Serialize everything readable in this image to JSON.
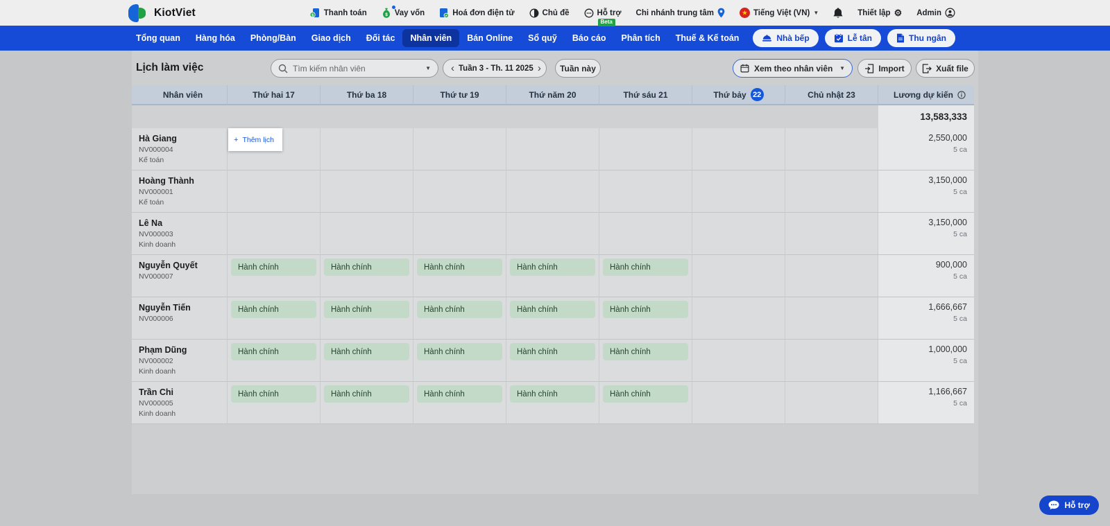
{
  "topbar": {
    "brand": "KiotViet",
    "items": [
      {
        "label": "Thanh toán"
      },
      {
        "label": "Vay vốn"
      },
      {
        "label": "Hoá đơn điện tử"
      },
      {
        "label": "Chủ đề"
      },
      {
        "label": "Hỗ trợ",
        "beta": "Beta"
      },
      {
        "label": "Chi nhánh trung tâm"
      },
      {
        "label": "Tiếng Việt (VN)"
      },
      {
        "label": "Thiết lập"
      },
      {
        "label": "Admin"
      }
    ]
  },
  "navbar": {
    "items": [
      "Tổng quan",
      "Hàng hóa",
      "Phòng/Bàn",
      "Giao dịch",
      "Đối tác",
      "Nhân viên",
      "Bán Online",
      "Sổ quỹ",
      "Báo cáo",
      "Phân tích",
      "Thuế & Kế toán"
    ],
    "active_index": 5,
    "quick_buttons": [
      "Nhà bếp",
      "Lễ tân",
      "Thu ngân"
    ]
  },
  "toolbar": {
    "title": "Lịch làm việc",
    "search_placeholder": "Tìm kiếm nhân viên",
    "week_label": "Tuần 3 - Th. 11 2025",
    "this_week_label": "Tuần này",
    "view_select_label": "Xem theo nhân viên",
    "import_label": "Import",
    "export_label": "Xuất file"
  },
  "table": {
    "columns": [
      {
        "label": "Nhân viên"
      },
      {
        "label": "Thứ hai 17"
      },
      {
        "label": "Thứ ba 18"
      },
      {
        "label": "Thứ tư 19"
      },
      {
        "label": "Thứ năm 20"
      },
      {
        "label": "Thứ sáu 21"
      },
      {
        "label": "Thứ bảy",
        "badge": "22",
        "active": true
      },
      {
        "label": "Chủ nhật 23",
        "muted": true
      },
      {
        "label": "Lương dự kiến",
        "info": true
      }
    ],
    "summary_total": "13,583,333",
    "add_shift_label": "Thêm lịch",
    "rows": [
      {
        "name": "Hà Giang",
        "code": "NV000004",
        "dept": "Kế toán",
        "shifts": [
          "",
          "",
          "",
          "",
          "",
          "",
          ""
        ],
        "salary": "2,550,000",
        "shift_count": "5 ca",
        "show_add_popup": true
      },
      {
        "name": "Hoàng Thành",
        "code": "NV000001",
        "dept": "Kế toán",
        "shifts": [
          "",
          "",
          "",
          "",
          "",
          "",
          ""
        ],
        "salary": "3,150,000",
        "shift_count": "5 ca"
      },
      {
        "name": "Lê Na",
        "code": "NV000003",
        "dept": "Kinh doanh",
        "shifts": [
          "",
          "",
          "",
          "",
          "",
          "",
          ""
        ],
        "salary": "3,150,000",
        "shift_count": "5 ca"
      },
      {
        "name": "Nguyễn Quyết",
        "code": "NV000007",
        "dept": "",
        "shifts": [
          "Hành chính",
          "Hành chính",
          "Hành chính",
          "Hành chính",
          "Hành chính",
          "",
          ""
        ],
        "salary": "900,000",
        "shift_count": "5 ca"
      },
      {
        "name": "Nguyễn Tiến",
        "code": "NV000006",
        "dept": "",
        "shifts": [
          "Hành chính",
          "Hành chính",
          "Hành chính",
          "Hành chính",
          "Hành chính",
          "",
          ""
        ],
        "salary": "1,666,667",
        "shift_count": "5 ca"
      },
      {
        "name": "Phạm Dũng",
        "code": "NV000002",
        "dept": "Kinh doanh",
        "shifts": [
          "Hành chính",
          "Hành chính",
          "Hành chính",
          "Hành chính",
          "Hành chính",
          "",
          ""
        ],
        "salary": "1,000,000",
        "shift_count": "5 ca"
      },
      {
        "name": "Trần Chi",
        "code": "NV000005",
        "dept": "Kinh doanh",
        "shifts": [
          "Hành chính",
          "Hành chính",
          "Hành chính",
          "Hành chính",
          "Hành chính",
          "",
          ""
        ],
        "salary": "1,166,667",
        "shift_count": "5 ca"
      }
    ]
  },
  "support_button": {
    "label": "Hỗ trợ"
  },
  "colors": {
    "navbar_blue": "#164bd7",
    "active_nav": "#0d339f",
    "today_blue": "#1557da",
    "shift_badge_bg": "#c3dac8",
    "shift_badge_text": "#26452f",
    "support_bg": "#1545cd",
    "header_bg": "#c3ceda",
    "row_bg": "#dbdcde",
    "salary_col_bg": "#e7e8ea"
  }
}
